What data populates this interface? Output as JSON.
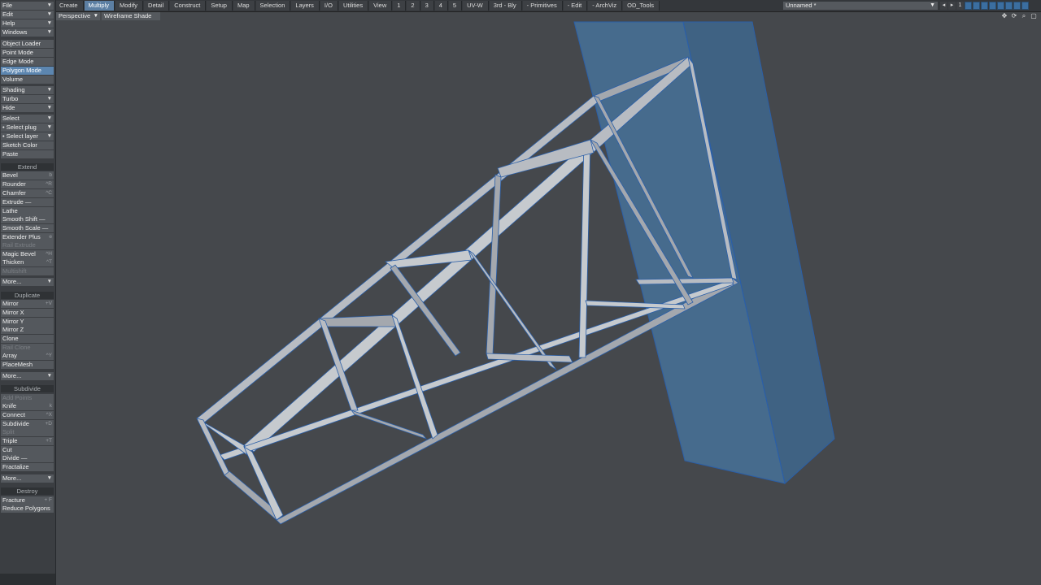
{
  "menu_tabs": [
    "Create",
    "Multiply",
    "Modify",
    "Detail",
    "Construct",
    "Setup",
    "Map",
    "Selection",
    "Layers",
    "I/O",
    "Utilities",
    "View",
    "1",
    "2",
    "3",
    "4",
    "5",
    "UV-W",
    "3rd - Bly",
    "- Primitives",
    "- Edit",
    "- ArchViz",
    "OD_Tools"
  ],
  "selected_tab": "Multiply",
  "scene_name": "Unnamed *",
  "nav": {
    "prev": "◂",
    "next": "▸",
    "layer_num": "1"
  },
  "sidebar": {
    "file": "File",
    "edit": "Edit",
    "help": "Help",
    "windows": "Windows",
    "object_loader": "Object Loader",
    "point_mode": "Point Mode",
    "edge_mode": "Edge Mode",
    "polygon_mode": "Polygon Mode",
    "volume": "Volume",
    "shading": "Shading",
    "turbo": "Turbo",
    "hide": "Hide",
    "select": "Select",
    "select_plug": "• Select plug",
    "select_layer": "• Select layer",
    "sketch_color": "Sketch Color",
    "paste": "Paste",
    "extend_head": "Extend",
    "bevel": "Bevel",
    "bevel_sc": "b",
    "rounder": "Rounder",
    "rounder_sc": "^R",
    "chamfer": "Chamfer",
    "chamfer_sc": "^C",
    "extrude": "Extrude —",
    "lathe": "Lathe",
    "smooth_shift": "Smooth Shift —",
    "smooth_scale": "Smooth Scale —",
    "extender_plus": "Extender Plus",
    "extender_plus_sc": "e",
    "rail_extrude": "Rail Extrude",
    "magic_bevel": "Magic Bevel",
    "magic_bevel_sc": "^H",
    "thicken": "Thicken",
    "thicken_sc": "^T",
    "multishift": "Multishift",
    "more1": "More...",
    "duplicate_head": "Duplicate",
    "mirror": "Mirror",
    "mirror_sc": "+V",
    "mirror_x": "Mirror X",
    "mirror_y": "Mirror Y",
    "mirror_z": "Mirror Z",
    "clone": "Clone",
    "rail_clone": "Rail Clone",
    "array": "Array",
    "array_sc": "^Y",
    "placemesh": "PlaceMesh",
    "more2": "More...",
    "subdivide_head": "Subdivide",
    "add_points": "Add Points",
    "knife": "Knife",
    "knife_sc": "k",
    "connect": "Connect",
    "connect_sc": "^X",
    "subdivide": "Subdivide",
    "subdivide_sc": "+D",
    "split": "Split",
    "triple": "Triple",
    "triple_sc": "+T",
    "cut": "Cut",
    "divide": "Divide —",
    "fractalize": "Fractalize",
    "more3": "More...",
    "destroy_head": "Destroy",
    "fracture": "Fracture",
    "fracture_sc": "+ F",
    "reduce_polygons": "Reduce Polygons"
  },
  "viewport": {
    "view_type": "Perspective",
    "shading_mode": "Wireframe Shade",
    "icons": [
      "move-icon",
      "rotate-icon",
      "zoom-icon",
      "maximize-icon"
    ]
  },
  "colors": {
    "background": "#45484c",
    "selected": "#5c86b0",
    "pillar": "#4a6e8f",
    "truss_edge": "#2b5fa8"
  }
}
